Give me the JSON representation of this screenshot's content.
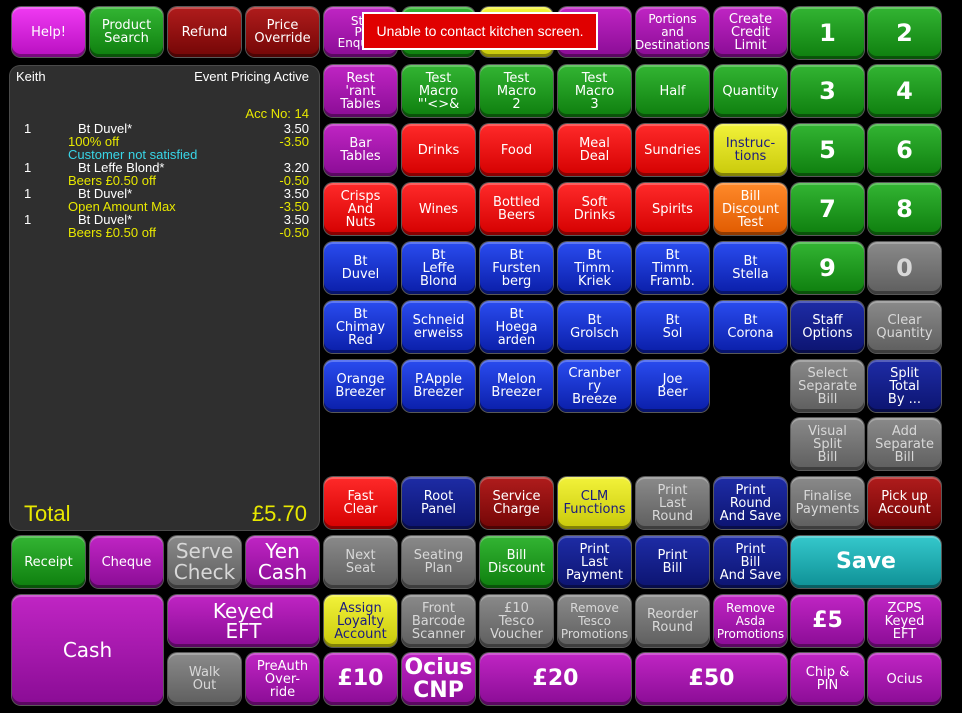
{
  "colors": {
    "background": "#000000",
    "panel": "#2f2f2f",
    "receipt_text": "#ffffff",
    "discount_text": "#e8e800",
    "note_text": "#38d6e8",
    "error_bg": "#e00000"
  },
  "error_message": "Unable to contact kitchen screen.",
  "top_row": {
    "help": "Help!",
    "product_search": "Product\nSearch",
    "refund": "Refund",
    "price_override": "Price\nOverride",
    "stock_enquiry": "Stk\nPr\nEnquiry",
    "portions": "Portions\nand\nDestinations",
    "create_credit": "Create\nCredit\nLimit"
  },
  "receipt": {
    "operator": "Keith",
    "status": "Event Pricing Active",
    "account": "Acc No: 14",
    "lines": [
      {
        "qty": "1",
        "name": "Bt Duvel*",
        "price": "3.50"
      },
      {
        "note": "100% off",
        "price": "-3.50"
      },
      {
        "note": "Customer not satisfied"
      },
      {
        "qty": "1",
        "name": "Bt Leffe Blond*",
        "price": "3.20"
      },
      {
        "note": "Beers £0.50 off",
        "price": "-0.50"
      },
      {
        "qty": "1",
        "name": "Bt Duvel*",
        "price": "3.50"
      },
      {
        "note": "Open Amount Max",
        "price": "-3.50"
      },
      {
        "qty": "1",
        "name": "Bt Duvel*",
        "price": "3.50"
      },
      {
        "note": "Beers £0.50 off",
        "price": "-0.50"
      }
    ],
    "total_label": "Total",
    "total_value": "£5.70"
  },
  "grid": {
    "rest_tables": "Rest\n'rant\nTables",
    "test_macro_1": "Test\nMacro\n\"'<>&",
    "test_macro_2": "Test\nMacro\n2",
    "test_macro_3": "Test\nMacro\n3",
    "half": "Half",
    "quantity": "Quantity",
    "bar_tables": "Bar\nTables",
    "drinks": "Drinks",
    "food": "Food",
    "meal_deal": "Meal\nDeal",
    "sundries": "Sundries",
    "instructions": "Instruc-\ntions",
    "crisps_nuts": "Crisps\nAnd\nNuts",
    "wines": "Wines",
    "bottled_beers": "Bottled\nBeers",
    "soft_drinks": "Soft\nDrinks",
    "spirits": "Spirits",
    "bill_discount_test": "Bill\nDiscount\nTest",
    "bt_duvel": "Bt\nDuvel",
    "bt_leffe": "Bt\nLeffe\nBlond",
    "bt_fursten": "Bt\nFursten\nberg",
    "bt_timm_kriek": "Bt\nTimm.\nKriek",
    "bt_timm_framb": "Bt\nTimm.\nFramb.",
    "bt_stella": "Bt\nStella",
    "bt_chimay": "Bt\nChimay\nRed",
    "schneid": "Schneid\nerweiss",
    "bt_hoegaarden": "Bt\nHoega\narden",
    "bt_grolsch": "Bt\nGrolsch",
    "bt_sol": "Bt\nSol",
    "bt_corona": "Bt\nCorona",
    "orange_breezer": "Orange\nBreezer",
    "papple_breezer": "P.Apple\nBreezer",
    "melon_breezer": "Melon\nBreezer",
    "cranberry_breeze": "Cranber\nry\nBreeze",
    "joe_beer": "Joe\nBeer",
    "fast_clear": "Fast\nClear",
    "root_panel": "Root\nPanel",
    "service_charge": "Service\nCharge",
    "clm_functions": "CLM\nFunctions",
    "print_last_round": "Print\nLast\nRound",
    "print_round_save": "Print\nRound\nAnd Save"
  },
  "keypad": {
    "k1": "1",
    "k2": "2",
    "k3": "3",
    "k4": "4",
    "k5": "5",
    "k6": "6",
    "k7": "7",
    "k8": "8",
    "k9": "9",
    "k0": "0",
    "staff_options": "Staff\nOptions",
    "clear_quantity": "Clear\nQuantity",
    "select_separate": "Select\nSeparate\nBill",
    "split_total": "Split\nTotal\nBy ...",
    "visual_split": "Visual\nSplit\nBill",
    "add_separate": "Add\nSeparate\nBill",
    "finalise_payments": "Finalise\nPayments",
    "pick_up_account": "Pick up\nAccount"
  },
  "bottom": {
    "receipt": "Receipt",
    "cheque": "Cheque",
    "serve_check": "Serve\nCheck",
    "yen_cash": "Yen\nCash",
    "cash": "Cash",
    "keyed_eft": "Keyed\nEFT",
    "walk_out": "Walk\nOut",
    "preauth_override": "PreAuth\nOver-\nride",
    "next_seat": "Next\nSeat",
    "seating_plan": "Seating\nPlan",
    "bill_discount": "Bill\nDiscount",
    "print_last_payment": "Print\nLast\nPayment",
    "print_bill": "Print\nBill",
    "print_bill_save": "Print\nBill\nAnd Save",
    "save": "Save",
    "assign_loyalty": "Assign\nLoyalty\nAccount",
    "front_barcode": "Front\nBarcode\nScanner",
    "tesco_voucher": "£10\nTesco\nVoucher",
    "remove_tesco": "Remove\nTesco\nPromotions",
    "reorder_round": "Reorder\nRound",
    "remove_asda": "Remove\nAsda\nPromotions",
    "five": "£5",
    "zcps_keyed": "ZCPS\nKeyed\nEFT",
    "ten": "£10",
    "ocius_cnp": "Ocius\nCNP",
    "twenty": "£20",
    "fifty": "£50",
    "chip_pin": "Chip &\nPIN",
    "ocius": "Ocius"
  }
}
